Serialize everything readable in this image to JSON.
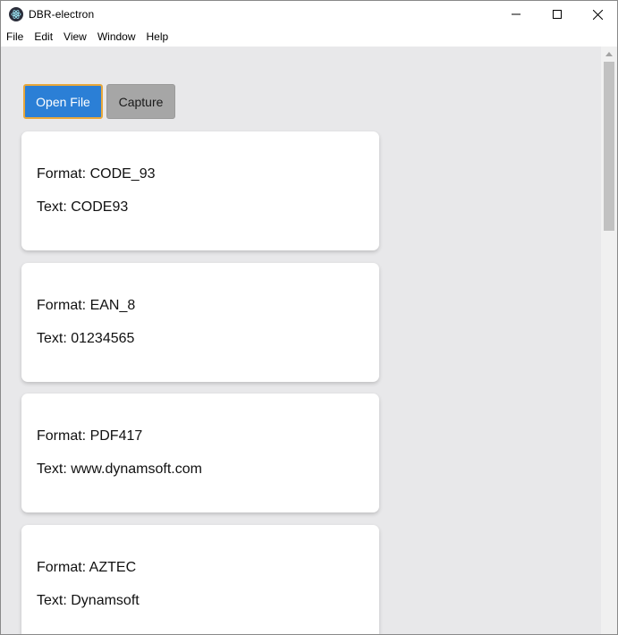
{
  "window": {
    "title": "DBR-electron"
  },
  "menu": [
    "File",
    "Edit",
    "View",
    "Window",
    "Help"
  ],
  "toolbar": {
    "open_label": "Open File",
    "capture_label": "Capture"
  },
  "results": [
    {
      "format_line": "Format: CODE_93",
      "text_line": "Text: CODE93"
    },
    {
      "format_line": "Format: EAN_8",
      "text_line": "Text: 01234565"
    },
    {
      "format_line": "Format: PDF417",
      "text_line": "Text: www.dynamsoft.com"
    },
    {
      "format_line": "Format: AZTEC",
      "text_line": "Text: Dynamsoft"
    }
  ],
  "colors": {
    "open_button": "#2b7fd6",
    "open_button_focus": "#e8a73a",
    "capture_button": "#a6a6a6",
    "content_background": "#e8e8ea"
  },
  "icons": {
    "app": "electron-icon",
    "minimize": "minimize-icon",
    "maximize": "maximize-icon",
    "close": "close-icon"
  }
}
